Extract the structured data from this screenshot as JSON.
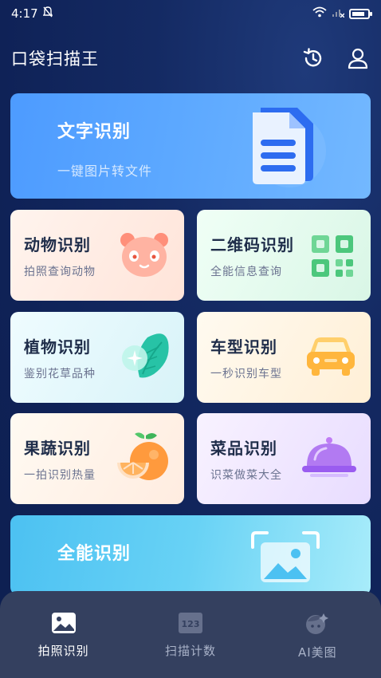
{
  "status_bar": {
    "time": "4:17",
    "battery_level": 0.85,
    "icons": [
      "silent-icon",
      "wifi-icon",
      "signal-icon",
      "battery-icon"
    ]
  },
  "app_bar": {
    "title": "口袋扫描王",
    "icons": [
      "history-icon",
      "user-icon"
    ]
  },
  "cards": {
    "text": {
      "title": "文字识别",
      "subtitle": "一键图片转文件",
      "icon": "document-icon"
    },
    "animal": {
      "title": "动物识别",
      "subtitle": "拍照查询动物",
      "icon": "panda-icon"
    },
    "qr": {
      "title": "二维码识别",
      "subtitle": "全能信息查询",
      "icon": "qr-code-icon"
    },
    "plant": {
      "title": "植物识别",
      "subtitle": "鉴别花草品种",
      "icon": "leaf-icon"
    },
    "car": {
      "title": "车型识别",
      "subtitle": "一秒识别车型",
      "icon": "car-icon"
    },
    "fruit": {
      "title": "果蔬识别",
      "subtitle": "一拍识别热量",
      "icon": "orange-icon"
    },
    "dish": {
      "title": "菜品识别",
      "subtitle": "识菜做菜大全",
      "icon": "cloche-icon"
    },
    "all": {
      "title": "全能识别",
      "icon": "image-scan-icon"
    }
  },
  "bottom_nav": {
    "tabs": [
      {
        "label": "拍照识别",
        "icon": "photo-icon",
        "active": true
      },
      {
        "label": "扫描计数",
        "icon": "count-123-icon",
        "active": false,
        "badge_text": "123"
      },
      {
        "label": "AI美图",
        "icon": "ai-face-icon",
        "active": false
      }
    ]
  },
  "colors": {
    "background": "#0f2257",
    "text_card": "#5ca8ff",
    "all_card": "#68d2f5",
    "nav_bar": "#34405f"
  }
}
